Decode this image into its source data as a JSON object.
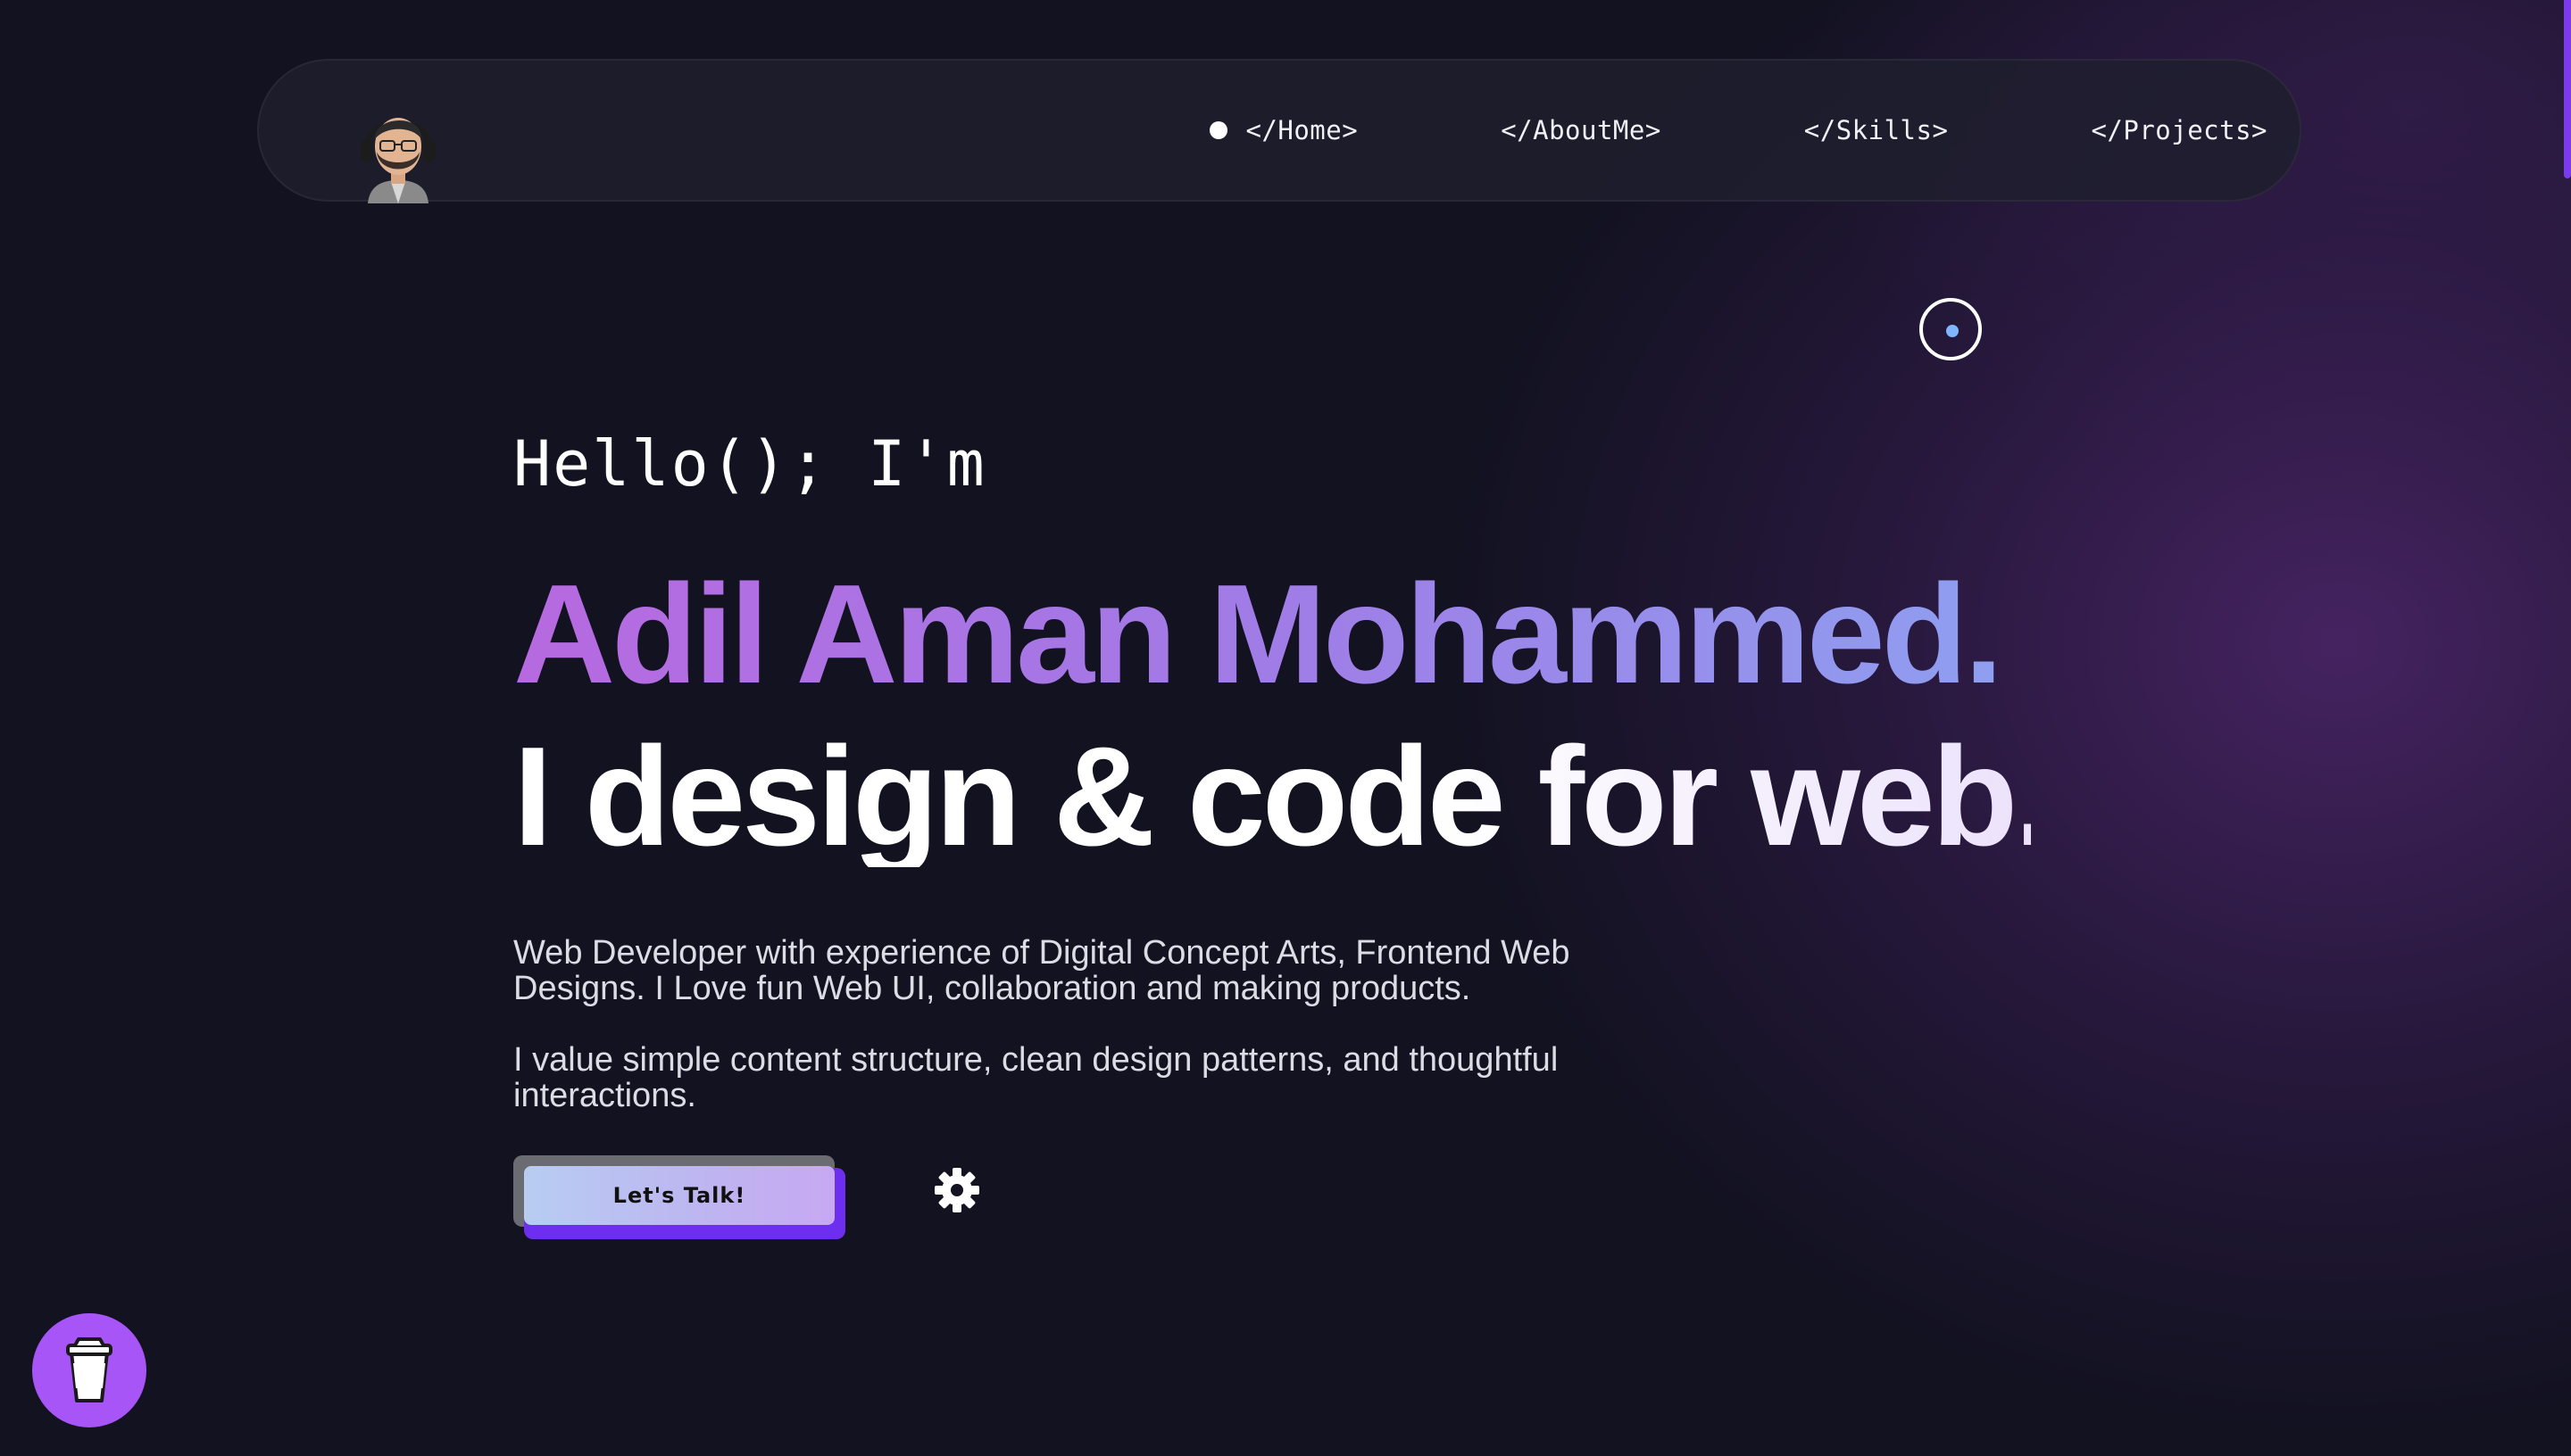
{
  "colors": {
    "background": "#121220",
    "accent": "#7c3aed",
    "name_gradient_start": "#b769e0",
    "name_gradient_end": "#8ea0f0",
    "coffee_button": "#a855f7"
  },
  "navbar": {
    "avatar_icon": "memoji-avatar",
    "links": [
      {
        "label": "</Home>",
        "active": true
      },
      {
        "label": "</AboutMe>",
        "active": false
      },
      {
        "label": "</Skills>",
        "active": false
      },
      {
        "label": "</Projects>",
        "active": false
      }
    ]
  },
  "hero": {
    "greeting": "Hello(); I'm",
    "name": "Adil Aman Mohammed.",
    "tagline": "I design & code for web.",
    "description_1": "Web Developer with experience of Digital Concept Arts, Frontend Web Designs. I Love fun Web UI, collaboration and making products.",
    "description_2": "I value simple content structure, clean design patterns, and thoughtful interactions."
  },
  "cta": {
    "talk_label": "Let's Talk!",
    "settings_icon": "gear-icon"
  },
  "floating": {
    "coffee_icon": "coffee-cup-icon",
    "cursor_icon": "cursor-ring-icon"
  }
}
